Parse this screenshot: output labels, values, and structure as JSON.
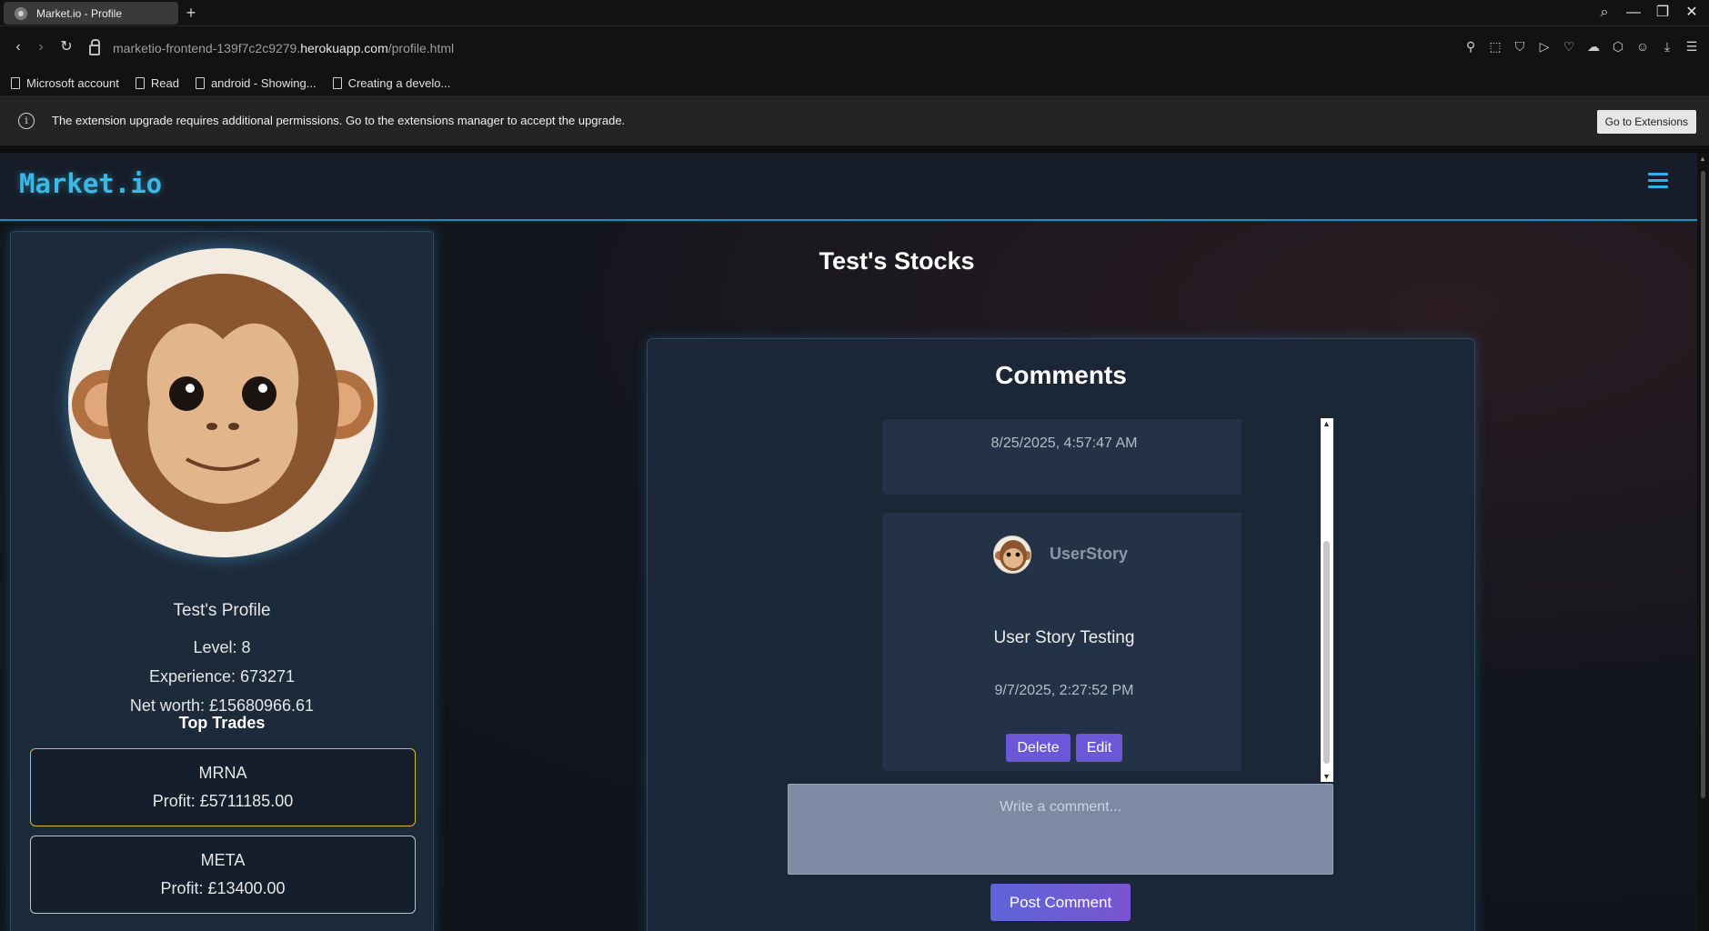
{
  "browser": {
    "tab_title": "Market.io - Profile",
    "new_tab": "+",
    "url_prefix": "marketio-frontend-139f7c2c9279.",
    "url_domain": "herokuapp.com",
    "url_path": "/profile.html",
    "bookmarks": [
      "Microsoft account",
      "Read",
      "android - Showing...",
      "Creating a develo..."
    ],
    "infobar_text": "The extension upgrade requires additional permissions. Go to the extensions manager to accept the upgrade.",
    "infobar_button": "Go to Extensions"
  },
  "site": {
    "logo": "Market.io"
  },
  "profile": {
    "name": "Test's Profile",
    "level": "Level: 8",
    "experience": "Experience: 673271",
    "net_worth": "Net worth: £15680966.61",
    "top_trades_title": "Top Trades",
    "trades": [
      {
        "symbol": "MRNA",
        "profit": "Profit: £5711185.00"
      },
      {
        "symbol": "META",
        "profit": "Profit: £13400.00"
      }
    ]
  },
  "stocks": {
    "title": "Test's Stocks"
  },
  "comments": {
    "title": "Comments",
    "items": [
      {
        "date": "8/25/2025, 4:57:47 AM"
      },
      {
        "user": "UserStory",
        "text": "User Story Testing",
        "date": "9/7/2025, 2:27:52 PM",
        "delete_label": "Delete",
        "edit_label": "Edit"
      }
    ],
    "input_placeholder": "Write a comment...",
    "post_label": "Post Comment"
  }
}
